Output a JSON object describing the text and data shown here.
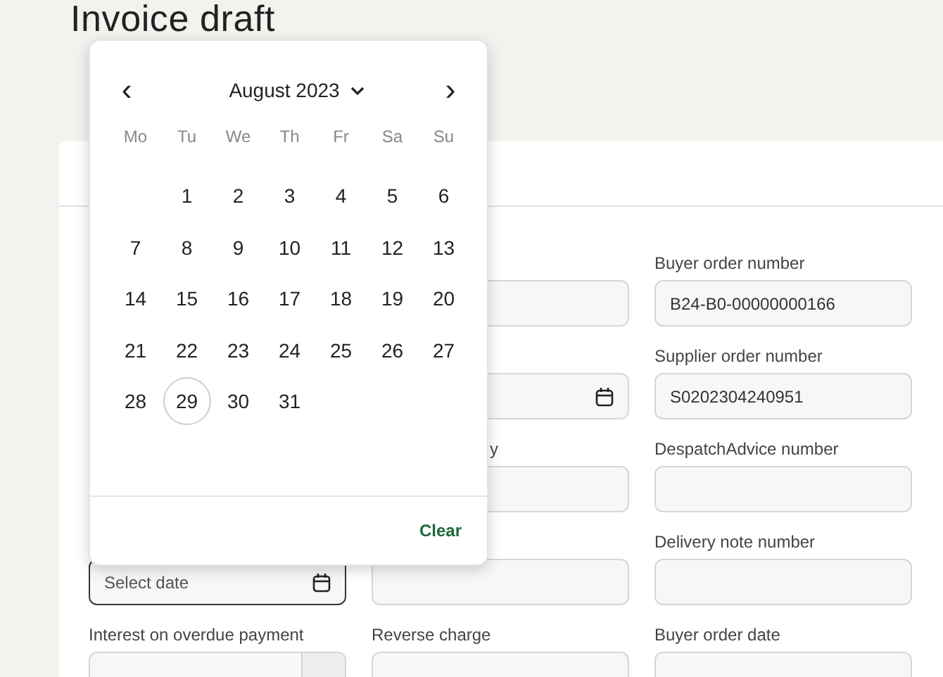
{
  "page_title": "Invoice draft",
  "form_rows": [
    {
      "cells": [
        null,
        {
          "field": {
            "kind": "text"
          }
        },
        {
          "label": "Buyer order number",
          "field": {
            "kind": "text",
            "value": "B24-B0-00000000166"
          }
        }
      ]
    },
    {
      "cells": [
        null,
        {
          "field": {
            "kind": "date",
            "focused": false
          }
        },
        {
          "label": "Supplier order number",
          "field": {
            "kind": "text",
            "value": "S0202304240951"
          }
        }
      ]
    },
    {
      "cells": [
        null,
        {
          "covered_label": "y",
          "field": {
            "kind": "text"
          }
        },
        {
          "label": "DespatchAdvice number",
          "field": {
            "kind": "text"
          }
        }
      ]
    },
    {
      "cells": [
        {
          "field": {
            "kind": "date",
            "placeholder": "Select date",
            "focused": true
          }
        },
        {
          "field": {
            "kind": "text"
          }
        },
        {
          "label": "Delivery note number",
          "field": {
            "kind": "text"
          }
        }
      ]
    },
    {
      "cells": [
        {
          "label": "Interest on overdue payment",
          "field": {
            "kind": "addon"
          }
        },
        {
          "label": "Reverse charge",
          "field": {
            "kind": "text"
          }
        },
        {
          "label": "Buyer order date",
          "field": {
            "kind": "text"
          }
        }
      ]
    }
  ],
  "datepicker": {
    "prev": "‹",
    "month": "August 2023",
    "next": "›",
    "weekdays": [
      "Mo",
      "Tu",
      "We",
      "Th",
      "Fr",
      "Sa",
      "Su"
    ],
    "weeks": [
      {
        "partial": true,
        "days": [
          {
            "label": "1",
            "selected": false
          },
          {
            "label": "2",
            "selected": false
          },
          {
            "label": "3",
            "selected": false
          },
          {
            "label": "4",
            "selected": false
          },
          {
            "label": "5",
            "selected": false
          },
          {
            "label": "6",
            "selected": false
          }
        ]
      },
      {
        "days": [
          {
            "label": "7",
            "selected": false
          },
          {
            "label": "8",
            "selected": false
          },
          {
            "label": "9",
            "selected": false
          },
          {
            "label": "10",
            "selected": false
          },
          {
            "label": "11",
            "selected": false
          },
          {
            "label": "12",
            "selected": false
          },
          {
            "label": "13",
            "selected": false
          }
        ]
      },
      {
        "days": [
          {
            "label": "14",
            "selected": false
          },
          {
            "label": "15",
            "selected": false
          },
          {
            "label": "16",
            "selected": false
          },
          {
            "label": "17",
            "selected": false
          },
          {
            "label": "18",
            "selected": false
          },
          {
            "label": "19",
            "selected": false
          },
          {
            "label": "20",
            "selected": false
          }
        ]
      },
      {
        "days": [
          {
            "label": "21",
            "selected": false
          },
          {
            "label": "22",
            "selected": false
          },
          {
            "label": "23",
            "selected": false
          },
          {
            "label": "24",
            "selected": false
          },
          {
            "label": "25",
            "selected": false
          },
          {
            "label": "26",
            "selected": false
          },
          {
            "label": "27",
            "selected": false
          }
        ]
      },
      {
        "days": [
          {
            "label": "28",
            "selected": false
          },
          {
            "label": "29",
            "selected": true
          },
          {
            "label": "30",
            "selected": false
          },
          {
            "label": "31",
            "selected": false
          }
        ]
      }
    ],
    "clear": "Clear"
  }
}
